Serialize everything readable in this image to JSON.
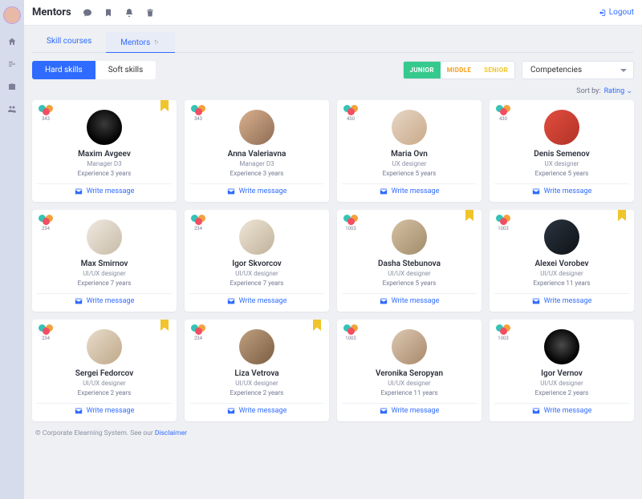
{
  "header": {
    "title": "Mentors",
    "logout": "Logout"
  },
  "tabs": {
    "courses": "Skill courses",
    "mentors": "Mentors"
  },
  "skill_pills": {
    "hard": "Hard skills",
    "soft": "Soft skills"
  },
  "levels": {
    "junior": "JUNIOR",
    "middle": "MIDDLE",
    "senior": "SENIOR"
  },
  "competencies_label": "Competencies",
  "sort": {
    "label": "Sort by:",
    "value": "Rating"
  },
  "write_message": "Write message",
  "mentors": [
    {
      "name": "Maxim Avgeev",
      "role": "Manager D3",
      "exp": "Experience 3 years",
      "badge": "343",
      "bookmark": true,
      "av": "av-m1"
    },
    {
      "name": "Anna Valeriavna",
      "role": "Manager D3",
      "exp": "Experience 3 years",
      "badge": "343",
      "bookmark": false,
      "av": "av-m2"
    },
    {
      "name": "Maria Ovn",
      "role": "UX designer",
      "exp": "Experience 5 years",
      "badge": "430",
      "bookmark": false,
      "av": "av-m3"
    },
    {
      "name": "Denis Semenov",
      "role": "UX designer",
      "exp": "Experience 5 years",
      "badge": "430",
      "bookmark": false,
      "av": "av-m4"
    },
    {
      "name": "Max Smirnov",
      "role": "UI/UX designer",
      "exp": "Experience 7 years",
      "badge": "234",
      "bookmark": false,
      "av": "av-m5"
    },
    {
      "name": "Igor Skvorcov",
      "role": "UI/UX designer",
      "exp": "Experience 7 years",
      "badge": "234",
      "bookmark": false,
      "av": "av-m6"
    },
    {
      "name": "Dasha Stebunova",
      "role": "UI/UX designer",
      "exp": "Experience 5 years",
      "badge": "1003",
      "bookmark": true,
      "av": "av-m7"
    },
    {
      "name": "Alexei Vorobev",
      "role": "UI/UX designer",
      "exp": "Experience 11 years",
      "badge": "1003",
      "bookmark": true,
      "av": "av-m8"
    },
    {
      "name": "Sergei Fedorcov",
      "role": "UI/UX designer",
      "exp": "Experience 2 years",
      "badge": "234",
      "bookmark": true,
      "av": "av-m9"
    },
    {
      "name": "Liza Vetrova",
      "role": "UI/UX designer",
      "exp": "Experience 2 years",
      "badge": "234",
      "bookmark": true,
      "av": "av-m10"
    },
    {
      "name": "Veronika Seropyan",
      "role": "UI/UX designer",
      "exp": "Experience 11 years",
      "badge": "1003",
      "bookmark": false,
      "av": "av-m11"
    },
    {
      "name": "Igor Vernov",
      "role": "UI/UX designer",
      "exp": "Experience 2 years",
      "badge": "1003",
      "bookmark": false,
      "av": "av-m12"
    }
  ],
  "footer": {
    "text": "© Corporate Elearning System.  See our ",
    "link": "Disclaimer"
  }
}
